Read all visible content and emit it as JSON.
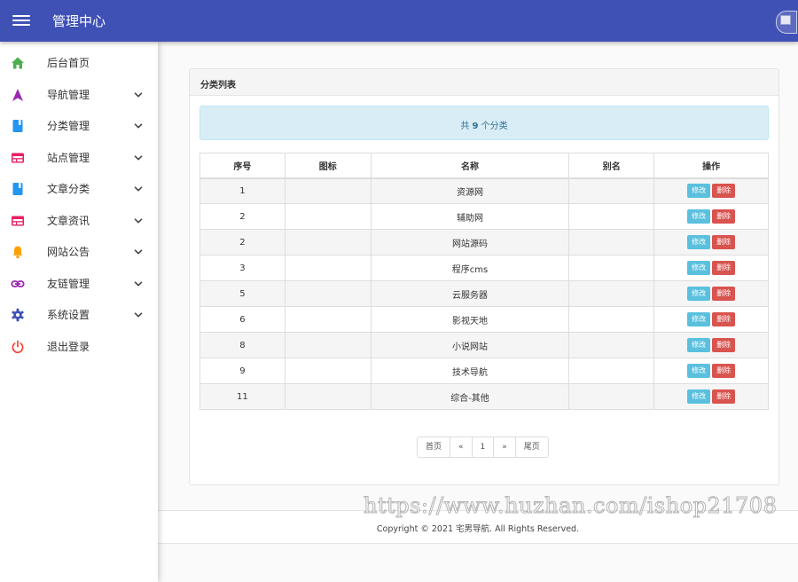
{
  "header": {
    "title": "管理中心"
  },
  "sidebar": {
    "items": [
      {
        "label": "后台首页",
        "icon": "home-icon",
        "color": "#4caf50",
        "chevron": false
      },
      {
        "label": "导航管理",
        "icon": "navigation-arrow-icon",
        "color": "#9c27b0",
        "chevron": true
      },
      {
        "label": "分类管理",
        "icon": "book-icon",
        "color": "#2196f3",
        "chevron": true
      },
      {
        "label": "站点管理",
        "icon": "web-icon",
        "color": "#e91e63",
        "chevron": true
      },
      {
        "label": "文章分类",
        "icon": "book-icon",
        "color": "#2196f3",
        "chevron": true
      },
      {
        "label": "文章资讯",
        "icon": "web-icon",
        "color": "#e91e63",
        "chevron": true
      },
      {
        "label": "网站公告",
        "icon": "bell-icon",
        "color": "#ffa000",
        "chevron": true
      },
      {
        "label": "友链管理",
        "icon": "link-icon",
        "color": "#9c27b0",
        "chevron": true
      },
      {
        "label": "系统设置",
        "icon": "gear-icon",
        "color": "#3f51b5",
        "chevron": true
      },
      {
        "label": "退出登录",
        "icon": "power-icon",
        "color": "#f44336",
        "chevron": false
      }
    ]
  },
  "panel": {
    "title": "分类列表",
    "notice_prefix": "共 ",
    "notice_count": "9",
    "notice_suffix": " 个分类"
  },
  "table": {
    "columns": [
      "序号",
      "图标",
      "名称",
      "别名",
      "操作"
    ],
    "rows": [
      {
        "id": "1",
        "icon": "",
        "name": "资源网",
        "alias": ""
      },
      {
        "id": "2",
        "icon": "",
        "name": "辅助网",
        "alias": ""
      },
      {
        "id": "2",
        "icon": "",
        "name": "网站源码",
        "alias": ""
      },
      {
        "id": "3",
        "icon": "",
        "name": "程序cms",
        "alias": ""
      },
      {
        "id": "5",
        "icon": "",
        "name": "云服务器",
        "alias": ""
      },
      {
        "id": "6",
        "icon": "",
        "name": "影视天地",
        "alias": ""
      },
      {
        "id": "8",
        "icon": "",
        "name": "小说网站",
        "alias": ""
      },
      {
        "id": "9",
        "icon": "",
        "name": "技术导航",
        "alias": ""
      },
      {
        "id": "11",
        "icon": "",
        "name": "综合-其他",
        "alias": ""
      }
    ],
    "edit_label": "修改",
    "delete_label": "删除"
  },
  "pagination": {
    "first": "首页",
    "prev": "«",
    "current": "1",
    "next": "»",
    "last": "尾页"
  },
  "footer": {
    "copyright": "Copyright © 2021 宅男导航. All Rights Reserved."
  },
  "watermark": "https://www.huzhan.com/ishop21708",
  "colors": {
    "header_bg": "#3f51b5",
    "notice_bg": "#d9edf7",
    "edit_btn": "#5bc0de",
    "delete_btn": "#d9534f"
  }
}
